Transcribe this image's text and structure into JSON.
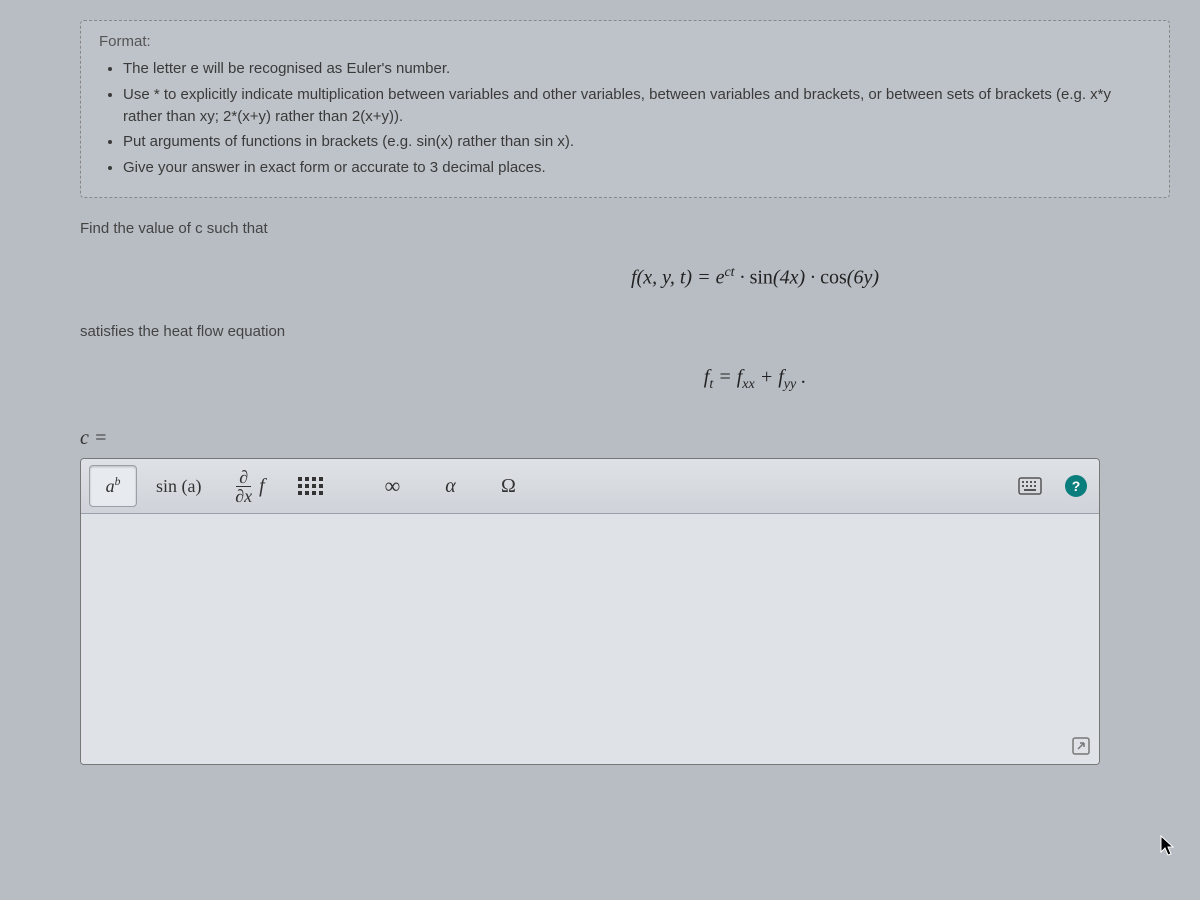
{
  "format": {
    "title": "Format:",
    "items": [
      "The letter e will be recognised as Euler's number.",
      "Use * to explicitly indicate multiplication between variables and other variables, between variables and brackets, or between sets of brackets (e.g. x*y rather than xy; 2*(x+y) rather than 2(x+y)).",
      "Put arguments of functions in brackets (e.g. sin(x) rather than sin x).",
      "Give your answer in exact form or accurate to 3 decimal places."
    ]
  },
  "question": {
    "intro": "Find the value of c such that",
    "eq1_html": "f(x, y, t) = e<span class=\"sup\">ct</span> · <span class=\"upright\">sin</span>(4x) · <span class=\"upright\">cos</span>(6y)",
    "satisfies": "satisfies the heat flow equation",
    "eq2_html": "f<span class=\"sub-math\">t</span> = f<span class=\"sub-math\">xx</span> + f<span class=\"sub-math\">yy</span> ."
  },
  "answer": {
    "prompt": "c ="
  },
  "toolbar": {
    "power": {
      "base": "a",
      "exp": "b"
    },
    "sin": "sin (a)",
    "dfrac_top": "∂",
    "dfrac_bot": "∂x",
    "dfrac_f": "f",
    "infty": "∞",
    "alpha": "α",
    "omega": "Ω",
    "help": "?"
  }
}
